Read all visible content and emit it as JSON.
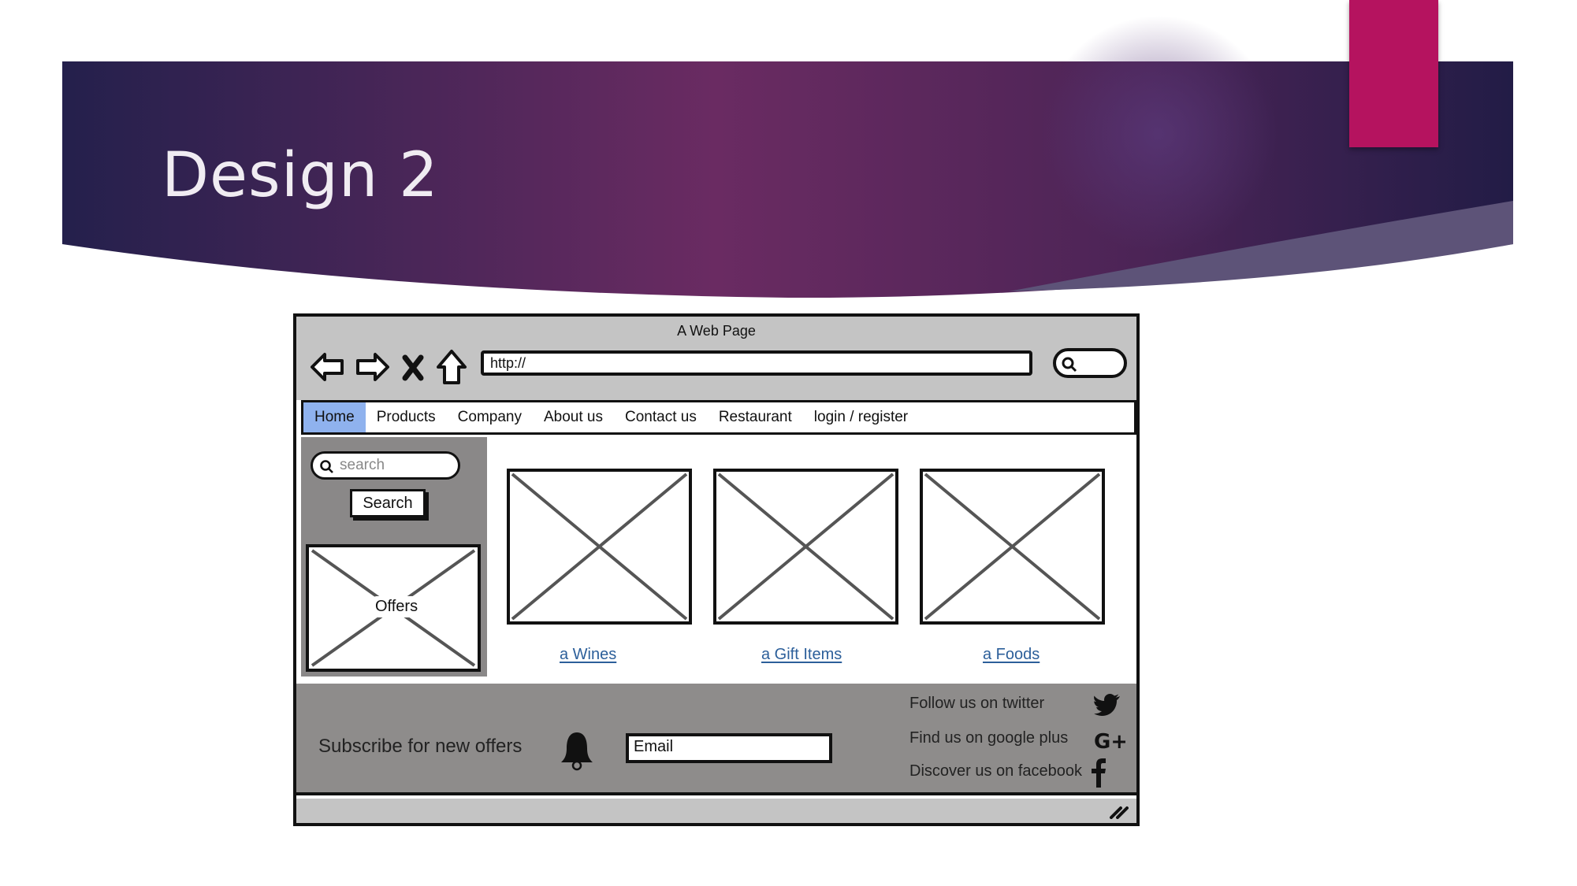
{
  "slide": {
    "title": "Design 2",
    "colors": {
      "banner_dark": "#221c48",
      "banner_mid": "#6b2a62",
      "accent": "#b5135f"
    }
  },
  "mockup": {
    "window_title": "A Web Page",
    "url": "http://",
    "nav_icons": [
      "back-arrow-icon",
      "forward-arrow-icon",
      "close-x-icon",
      "home-icon"
    ],
    "nav": {
      "items": [
        {
          "label": "Home",
          "active": true
        },
        {
          "label": "Products",
          "active": false
        },
        {
          "label": "Company",
          "active": false
        },
        {
          "label": "About us",
          "active": false
        },
        {
          "label": "Contact us",
          "active": false
        },
        {
          "label": "Restaurant",
          "active": false
        },
        {
          "label": "login / register",
          "active": false
        }
      ],
      "active_color": "#8fb2ee"
    },
    "sidebar": {
      "search_placeholder": "search",
      "search_button": "Search",
      "offers_label": "Offers"
    },
    "products": [
      {
        "link": "a Wines"
      },
      {
        "link": "a Gift Items"
      },
      {
        "link": "a Foods"
      }
    ],
    "footer": {
      "subscribe_text": "Subscribe for new offers",
      "email_value": "Email",
      "social": [
        {
          "text": "Follow us on twitter",
          "icon": "twitter-icon"
        },
        {
          "text": "Find us on google plus",
          "icon": "google-plus-icon"
        },
        {
          "text": "Discover us on facebook",
          "icon": "facebook-icon"
        }
      ]
    }
  }
}
